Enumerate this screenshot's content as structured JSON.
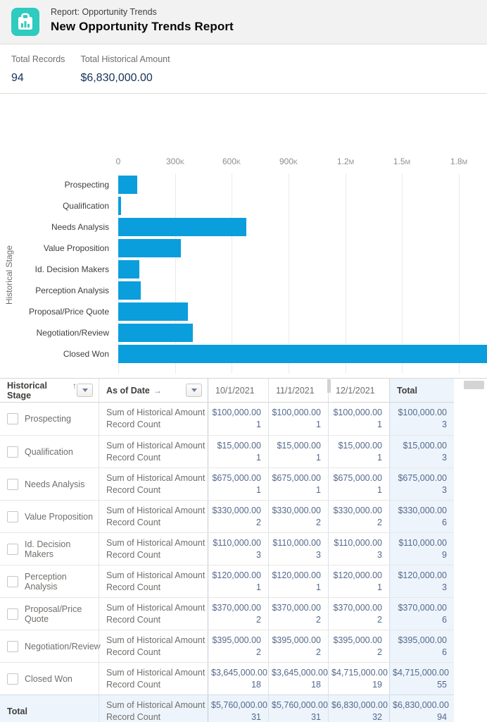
{
  "header": {
    "category": "Report: Opportunity Trends",
    "title": "New Opportunity Trends Report",
    "icon": "report-clipboard-chart-icon",
    "icon_color": "#2ECBBE"
  },
  "summary": {
    "stats": [
      {
        "label": "Total Records",
        "value": "94"
      },
      {
        "label": "Total Historical Amount",
        "value": "$6,830,000.00"
      }
    ]
  },
  "chart_data": {
    "type": "bar",
    "orientation": "horizontal",
    "categories": [
      "Prospecting",
      "Qualification",
      "Needs Analysis",
      "Value Proposition",
      "Id. Decision Makers",
      "Perception Analysis",
      "Proposal/Price Quote",
      "Negotiation/Review",
      "Closed Won"
    ],
    "values": [
      100000,
      15000,
      675000,
      330000,
      110000,
      120000,
      370000,
      395000,
      4715000
    ],
    "title": "",
    "xlabel": "",
    "ylabel": "Historical Stage",
    "xlim": [
      0,
      1800000
    ],
    "x_tick_labels": [
      "0",
      "300K",
      "600K",
      "900K",
      "1.2M",
      "1.5M",
      "1.8M"
    ],
    "grid": "vertical-only",
    "legend": "none",
    "bar_color": "#0a9edd",
    "note": "Closed Won bar exceeds axis maximum and is clipped at the right edge"
  },
  "table": {
    "stage_header": {
      "label": "Historical Stage",
      "sort_icon": "↑"
    },
    "date_header": {
      "label": "As of Date",
      "sort_icon": "→"
    },
    "columns": [
      "10/1/2021",
      "11/1/2021",
      "12/1/2021"
    ],
    "total_column_label": "Total",
    "measure_labels": [
      "Sum of Historical Amount",
      "Record Count"
    ],
    "rows": [
      {
        "stage": "Prospecting",
        "amounts": [
          "$100,000.00",
          "$100,000.00",
          "$100,000.00",
          "$100,000.00"
        ],
        "counts": [
          "1",
          "1",
          "1",
          "3"
        ]
      },
      {
        "stage": "Qualification",
        "amounts": [
          "$15,000.00",
          "$15,000.00",
          "$15,000.00",
          "$15,000.00"
        ],
        "counts": [
          "1",
          "1",
          "1",
          "3"
        ]
      },
      {
        "stage": "Needs Analysis",
        "amounts": [
          "$675,000.00",
          "$675,000.00",
          "$675,000.00",
          "$675,000.00"
        ],
        "counts": [
          "1",
          "1",
          "1",
          "3"
        ]
      },
      {
        "stage": "Value Proposition",
        "amounts": [
          "$330,000.00",
          "$330,000.00",
          "$330,000.00",
          "$330,000.00"
        ],
        "counts": [
          "2",
          "2",
          "2",
          "6"
        ]
      },
      {
        "stage": "Id. Decision Makers",
        "amounts": [
          "$110,000.00",
          "$110,000.00",
          "$110,000.00",
          "$110,000.00"
        ],
        "counts": [
          "3",
          "3",
          "3",
          "9"
        ]
      },
      {
        "stage": "Perception Analysis",
        "amounts": [
          "$120,000.00",
          "$120,000.00",
          "$120,000.00",
          "$120,000.00"
        ],
        "counts": [
          "1",
          "1",
          "1",
          "3"
        ]
      },
      {
        "stage": "Proposal/Price Quote",
        "amounts": [
          "$370,000.00",
          "$370,000.00",
          "$370,000.00",
          "$370,000.00"
        ],
        "counts": [
          "2",
          "2",
          "2",
          "6"
        ]
      },
      {
        "stage": "Negotiation/Review",
        "amounts": [
          "$395,000.00",
          "$395,000.00",
          "$395,000.00",
          "$395,000.00"
        ],
        "counts": [
          "2",
          "2",
          "2",
          "6"
        ]
      },
      {
        "stage": "Closed Won",
        "amounts": [
          "$3,645,000.00",
          "$3,645,000.00",
          "$4,715,000.00",
          "$4,715,000.00"
        ],
        "counts": [
          "18",
          "18",
          "19",
          "55"
        ]
      }
    ],
    "total_row": {
      "stage": "Total",
      "amounts": [
        "$5,760,000.00",
        "$5,760,000.00",
        "$6,830,000.00",
        "$6,830,000.00"
      ],
      "counts": [
        "31",
        "31",
        "32",
        "94"
      ]
    }
  }
}
